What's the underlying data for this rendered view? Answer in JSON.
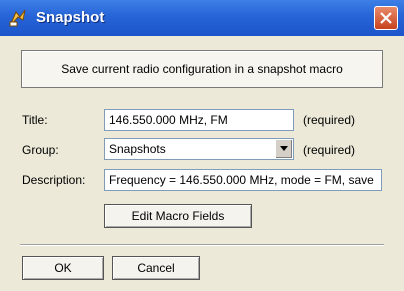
{
  "window": {
    "title": "Snapshot",
    "close_icon": "close-icon"
  },
  "main": {
    "snapshot_button_label": "Save current radio configuration in a snapshot macro",
    "title_label": "Title:",
    "title_value": "146.550.000 MHz, FM",
    "title_required": "(required)",
    "group_label": "Group:",
    "group_value": "Snapshots",
    "group_required": "(required)",
    "description_label": "Description:",
    "description_value": "Frequency = 146.550.000 MHz, mode = FM, save",
    "edit_macro_fields_label": "Edit Macro Fields"
  },
  "footer": {
    "ok_label": "OK",
    "cancel_label": "Cancel"
  }
}
